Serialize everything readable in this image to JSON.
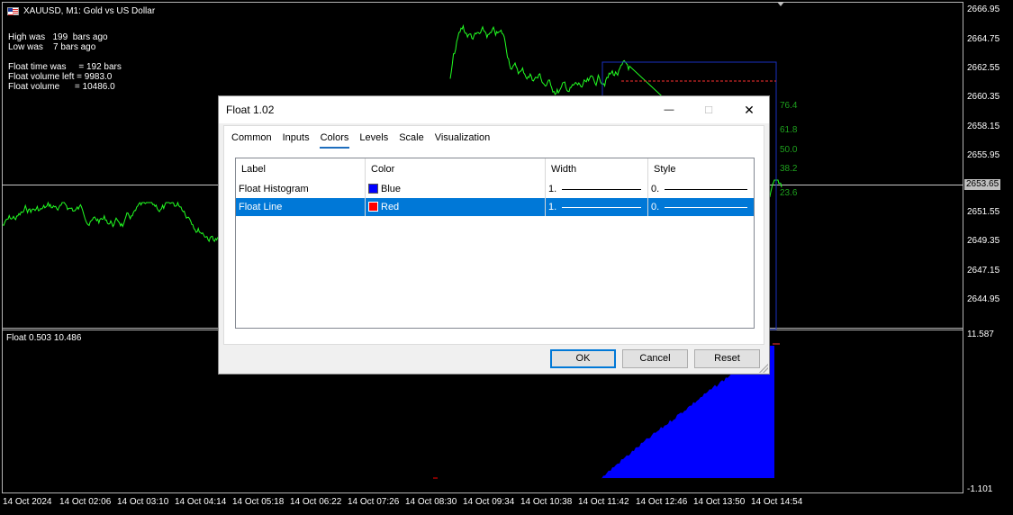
{
  "chart": {
    "symbol_title": "XAUUSD, M1:  Gold vs US Dollar",
    "info_lines": [
      "High was   199  bars ago",
      "Low was    7 bars ago",
      "Float time was     = 192 bars",
      "Float volume left = 9983.0",
      "Float volume      = 10486.0"
    ],
    "price_axis": [
      "2666.95",
      "2664.75",
      "2662.55",
      "2660.35",
      "2658.15",
      "2655.95",
      "2651.55",
      "2649.35",
      "2647.15",
      "2644.95"
    ],
    "current_price": "2653.65",
    "fib_levels": [
      "76.4",
      "61.8",
      "50.0",
      "38.2",
      "23.6"
    ],
    "subwindow_title": "Float 0.503 10.486",
    "subwindow_axis": [
      "11.587",
      "-1.101"
    ],
    "time_axis": [
      "14 Oct 2024",
      "14 Oct 02:06",
      "14 Oct 03:10",
      "14 Oct 04:14",
      "14 Oct 05:18",
      "14 Oct 06:22",
      "14 Oct 07:26",
      "14 Oct 08:30",
      "14 Oct 09:34",
      "14 Oct 10:38",
      "14 Oct 11:42",
      "14 Oct 12:46",
      "14 Oct 13:50",
      "14 Oct 14:54"
    ],
    "colors": {
      "price_line": "#22ff22",
      "histogram": "#0000ff",
      "fib_box": "#1a2fbf",
      "float_line": "#ff0000",
      "fib_text": "#1ea11e"
    }
  },
  "dialog": {
    "title": "Float 1.02",
    "tabs": [
      "Common",
      "Inputs",
      "Colors",
      "Levels",
      "Scale",
      "Visualization"
    ],
    "active_tab": "Colors",
    "columns": [
      "Label",
      "Color",
      "Width",
      "Style"
    ],
    "rows": [
      {
        "label": "Float Histogram",
        "color_name": "Blue",
        "color_hex": "#0000ff",
        "width": "1.",
        "style": "0.",
        "selected": false
      },
      {
        "label": "Float Line",
        "color_name": "Red",
        "color_hex": "#ff0000",
        "width": "1.",
        "style": "0.",
        "selected": true
      }
    ],
    "buttons": {
      "ok": "OK",
      "cancel": "Cancel",
      "reset": "Reset"
    },
    "window_controls": {
      "minimize": "—",
      "maximize": "☐",
      "close": "✕"
    }
  }
}
